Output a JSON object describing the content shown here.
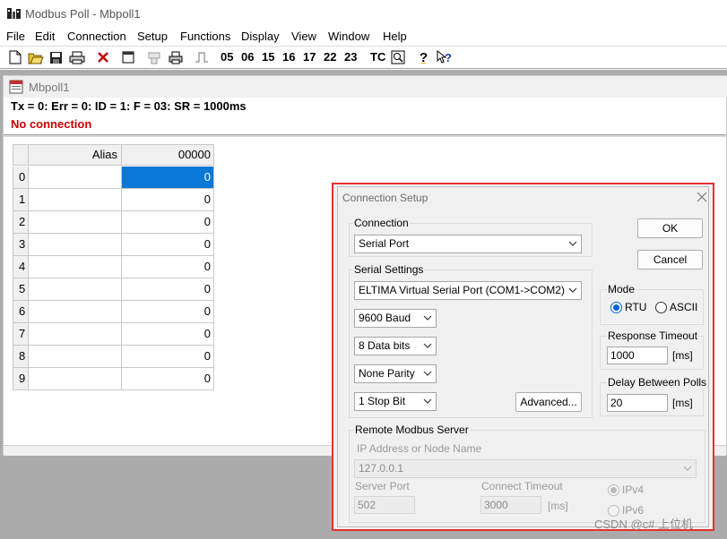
{
  "window": {
    "title": "Modbus Poll - Mbpoll1"
  },
  "menu": [
    "File",
    "Edit",
    "Connection",
    "Setup",
    "Functions",
    "Display",
    "View",
    "Window",
    "Help"
  ],
  "toolbar": {
    "icons": [
      "new-icon",
      "open-icon",
      "save-icon",
      "print-icon",
      "disconnect-icon",
      "window-icon",
      "connect-icon",
      "printer-icon",
      "pulse-icon",
      "read-write-icon",
      "help-icon",
      "context-help-icon"
    ],
    "function_codes": [
      "05",
      "06",
      "15",
      "16",
      "17",
      "22",
      "23"
    ],
    "tc_label": "TC"
  },
  "child": {
    "title": "Mbpoll1",
    "status": "Tx = 0: Err = 0: ID = 1: F = 03: SR = 1000ms",
    "connection": "No connection"
  },
  "grid": {
    "headers": [
      "Alias",
      "00000"
    ],
    "rows": [
      {
        "index": "0",
        "alias": "",
        "value": "0"
      },
      {
        "index": "1",
        "alias": "",
        "value": "0"
      },
      {
        "index": "2",
        "alias": "",
        "value": "0"
      },
      {
        "index": "3",
        "alias": "",
        "value": "0"
      },
      {
        "index": "4",
        "alias": "",
        "value": "0"
      },
      {
        "index": "5",
        "alias": "",
        "value": "0"
      },
      {
        "index": "6",
        "alias": "",
        "value": "0"
      },
      {
        "index": "7",
        "alias": "",
        "value": "0"
      },
      {
        "index": "8",
        "alias": "",
        "value": "0"
      },
      {
        "index": "9",
        "alias": "",
        "value": "0"
      }
    ]
  },
  "dialog": {
    "title": "Connection Setup",
    "connection_label": "Connection",
    "connection_value": "Serial Port",
    "serial_label": "Serial Settings",
    "port_value": "ELTIMA Virtual Serial Port (COM1->COM2)",
    "baud_value": "9600 Baud",
    "data_bits_value": "8 Data bits",
    "parity_value": "None Parity",
    "stop_bits_value": "1 Stop Bit",
    "advanced_label": "Advanced...",
    "ok_label": "OK",
    "cancel_label": "Cancel",
    "mode_label": "Mode",
    "mode_rtu": "RTU",
    "mode_ascii": "ASCII",
    "response_label": "Response Timeout",
    "response_value": "1000",
    "response_unit": "[ms]",
    "delay_label": "Delay Between Polls",
    "delay_value": "20",
    "delay_unit": "[ms]",
    "remote_label": "Remote Modbus Server",
    "ip_label": "IP Address or Node Name",
    "ip_value": "127.0.0.1",
    "server_port_label": "Server Port",
    "server_port_value": "502",
    "connect_timeout_label": "Connect Timeout",
    "connect_timeout_value": "3000",
    "connect_timeout_unit": "[ms]",
    "ipv4_label": "IPv4",
    "ipv6_label": "IPv6"
  },
  "watermark": "CSDN @c# 上位机"
}
